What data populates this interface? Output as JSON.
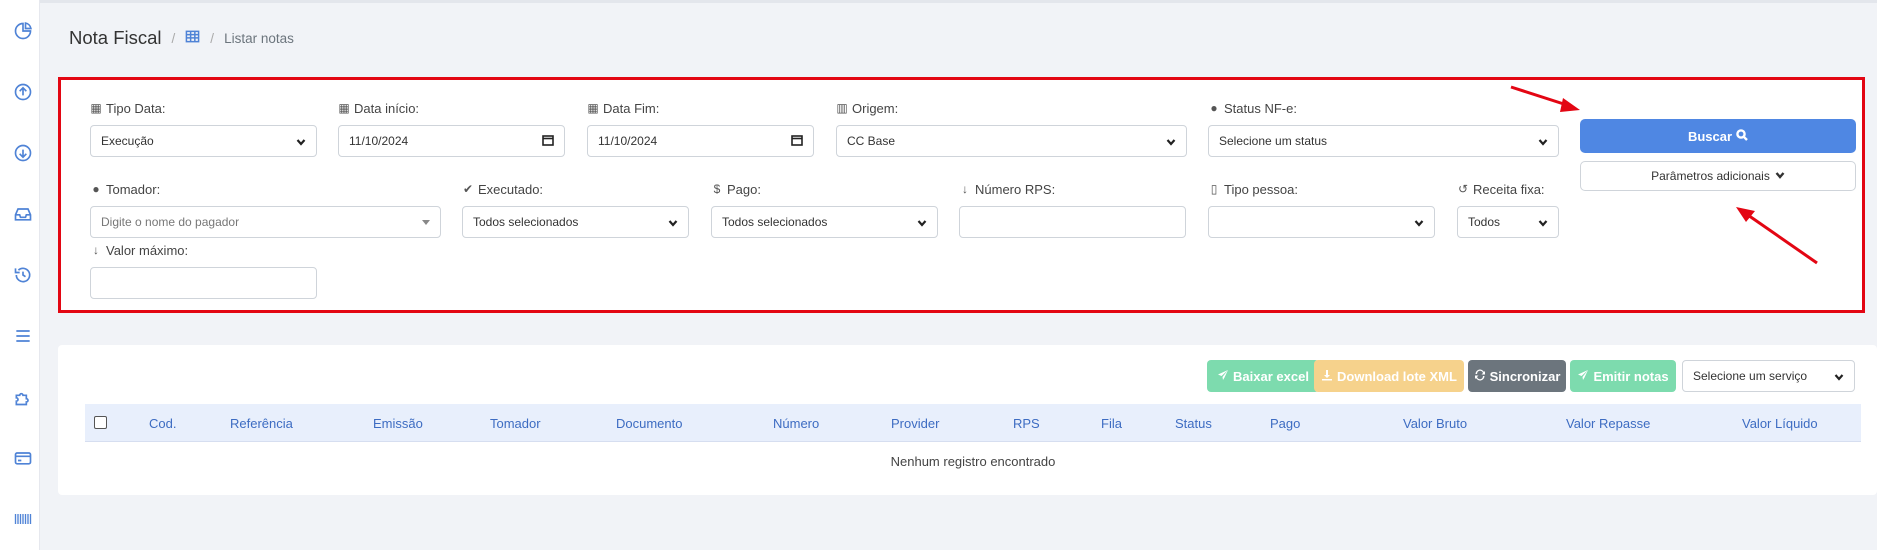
{
  "breadcrumb": {
    "title": "Nota Fiscal",
    "current": "Listar notas"
  },
  "filters": {
    "tipo_data": {
      "label": "Tipo Data:",
      "value": "Execução"
    },
    "data_inicio": {
      "label": "Data início:",
      "value": "11/10/2024"
    },
    "data_fim": {
      "label": "Data Fim:",
      "value": "11/10/2024"
    },
    "origem": {
      "label": "Origem:",
      "value": "CC Base"
    },
    "status_nfe": {
      "label": "Status NF-e:",
      "value": "Selecione um status"
    },
    "tomador": {
      "label": "Tomador:",
      "placeholder": "Digite o nome do pagador"
    },
    "executado": {
      "label": "Executado:",
      "value": "Todos selecionados"
    },
    "pago": {
      "label": "Pago:",
      "value": "Todos selecionados"
    },
    "numero_rps": {
      "label": "Número RPS:",
      "value": ""
    },
    "tipo_pessoa": {
      "label": "Tipo pessoa:",
      "value": ""
    },
    "receita_fixa": {
      "label": "Receita fixa:",
      "value": "Todos"
    },
    "valor_maximo": {
      "label": "Valor máximo:",
      "value": ""
    }
  },
  "actions": {
    "buscar": "Buscar",
    "parametros": "Parâmetros adicionais"
  },
  "toolbar": {
    "baixar_excel": "Baixar excel",
    "download_xml": "Download lote XML",
    "sincronizar": "Sincronizar",
    "emitir_notas": "Emitir notas",
    "servico_placeholder": "Selecione um serviço"
  },
  "colors": {
    "primary": "#4f87e3",
    "success_faded": "#7ddbae",
    "warning_faded": "#f6d28c",
    "secondary": "#6c757d",
    "annotation": "#e30613"
  },
  "table": {
    "columns": [
      "Cod.",
      "Referência",
      "Emissão",
      "Tomador",
      "Documento",
      "Número",
      "Provider",
      "RPS",
      "Fila",
      "Status",
      "Pago",
      "Valor Bruto",
      "Valor Repasse",
      "Valor Líquido"
    ],
    "empty_message": "Nenhum registro encontrado"
  }
}
